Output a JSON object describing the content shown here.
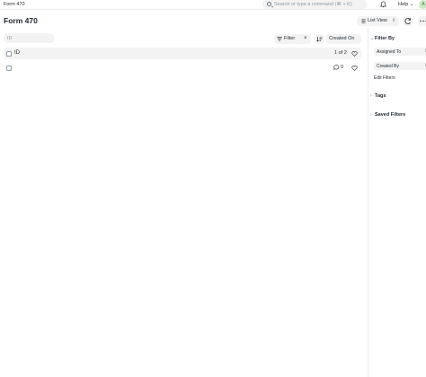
{
  "navbar": {
    "breadcrumb": "Form 470",
    "search_placeholder": "Search or type a command (⌘ + K)",
    "help_label": "Help",
    "avatar_initial": "A"
  },
  "page": {
    "title": "Form 470",
    "list_view_label": "List View"
  },
  "filters": {
    "id_placeholder": "ID",
    "filter_label": "Filter",
    "clear_label": "×",
    "sort_label": "Created On"
  },
  "list": {
    "header_id": "ID",
    "count_text": "1 of 2",
    "rows": [
      {
        "comment_count": "0",
        "separator": "·"
      }
    ]
  },
  "sidebar": {
    "filter_by": "Filter By",
    "assigned_to": "Assigned To",
    "created_by": "Created By",
    "edit_filters": "Edit Filters",
    "tags": "Tags",
    "saved_filters": "Saved Filters"
  },
  "colors": {
    "accent": "#1f272e",
    "muted": "#8d99a6",
    "control_bg": "#f3f3f3"
  }
}
